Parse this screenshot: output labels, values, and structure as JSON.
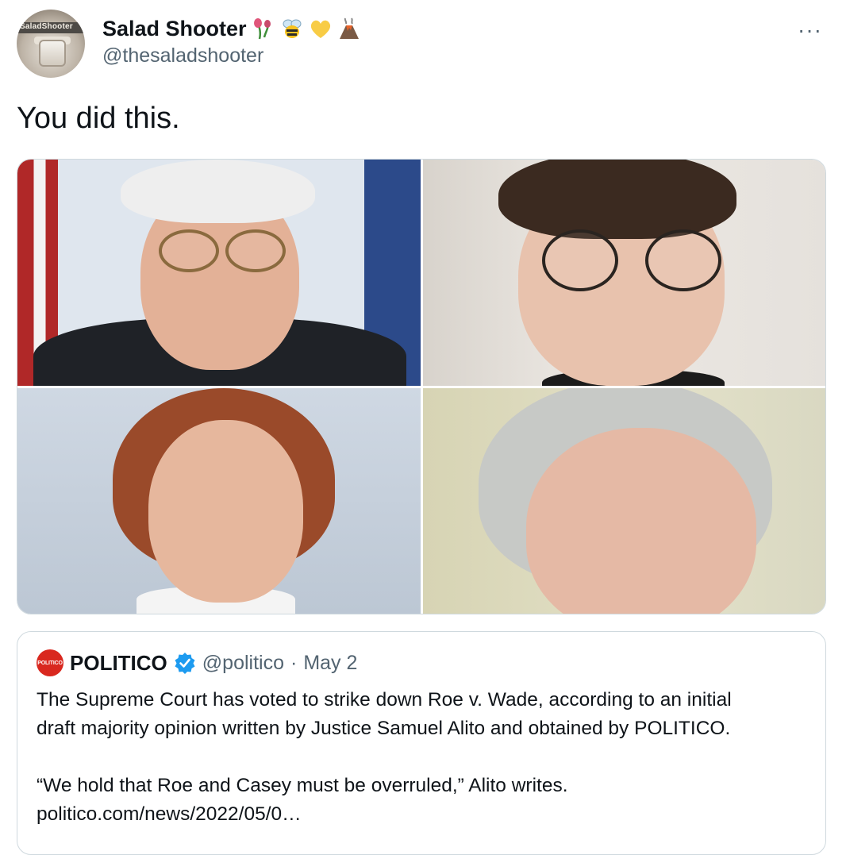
{
  "author": {
    "display_name": "Salad Shooter",
    "handle": "@thesaladshooter",
    "avatar_text": "SaladShooter",
    "emojis": [
      "wilted-flower-icon",
      "bee-icon",
      "yellow-heart-icon",
      "volcano-icon"
    ]
  },
  "menu": {
    "more_label": "···"
  },
  "tweet": {
    "text": "You did this."
  },
  "photos": [
    "photo-1",
    "photo-2",
    "photo-3",
    "photo-4"
  ],
  "quote": {
    "avatar_text": "POLITICO",
    "name": "POLITICO",
    "handle": "@politico",
    "separator": "·",
    "date": "May 2",
    "line1": "The Supreme Court has voted to strike down Roe v. Wade, according to an initial",
    "line2": "draft majority opinion written by Justice Samuel Alito and obtained by POLITICO.",
    "line3": "“We hold that Roe and Casey must be overruled,” Alito writes.",
    "link": "politico.com/news/2022/05/0…"
  },
  "colors": {
    "accent": "#1d9bf0",
    "text": "#0f1419",
    "muted": "#536471",
    "border": "#cfd9de",
    "politico_red": "#d9281f"
  }
}
